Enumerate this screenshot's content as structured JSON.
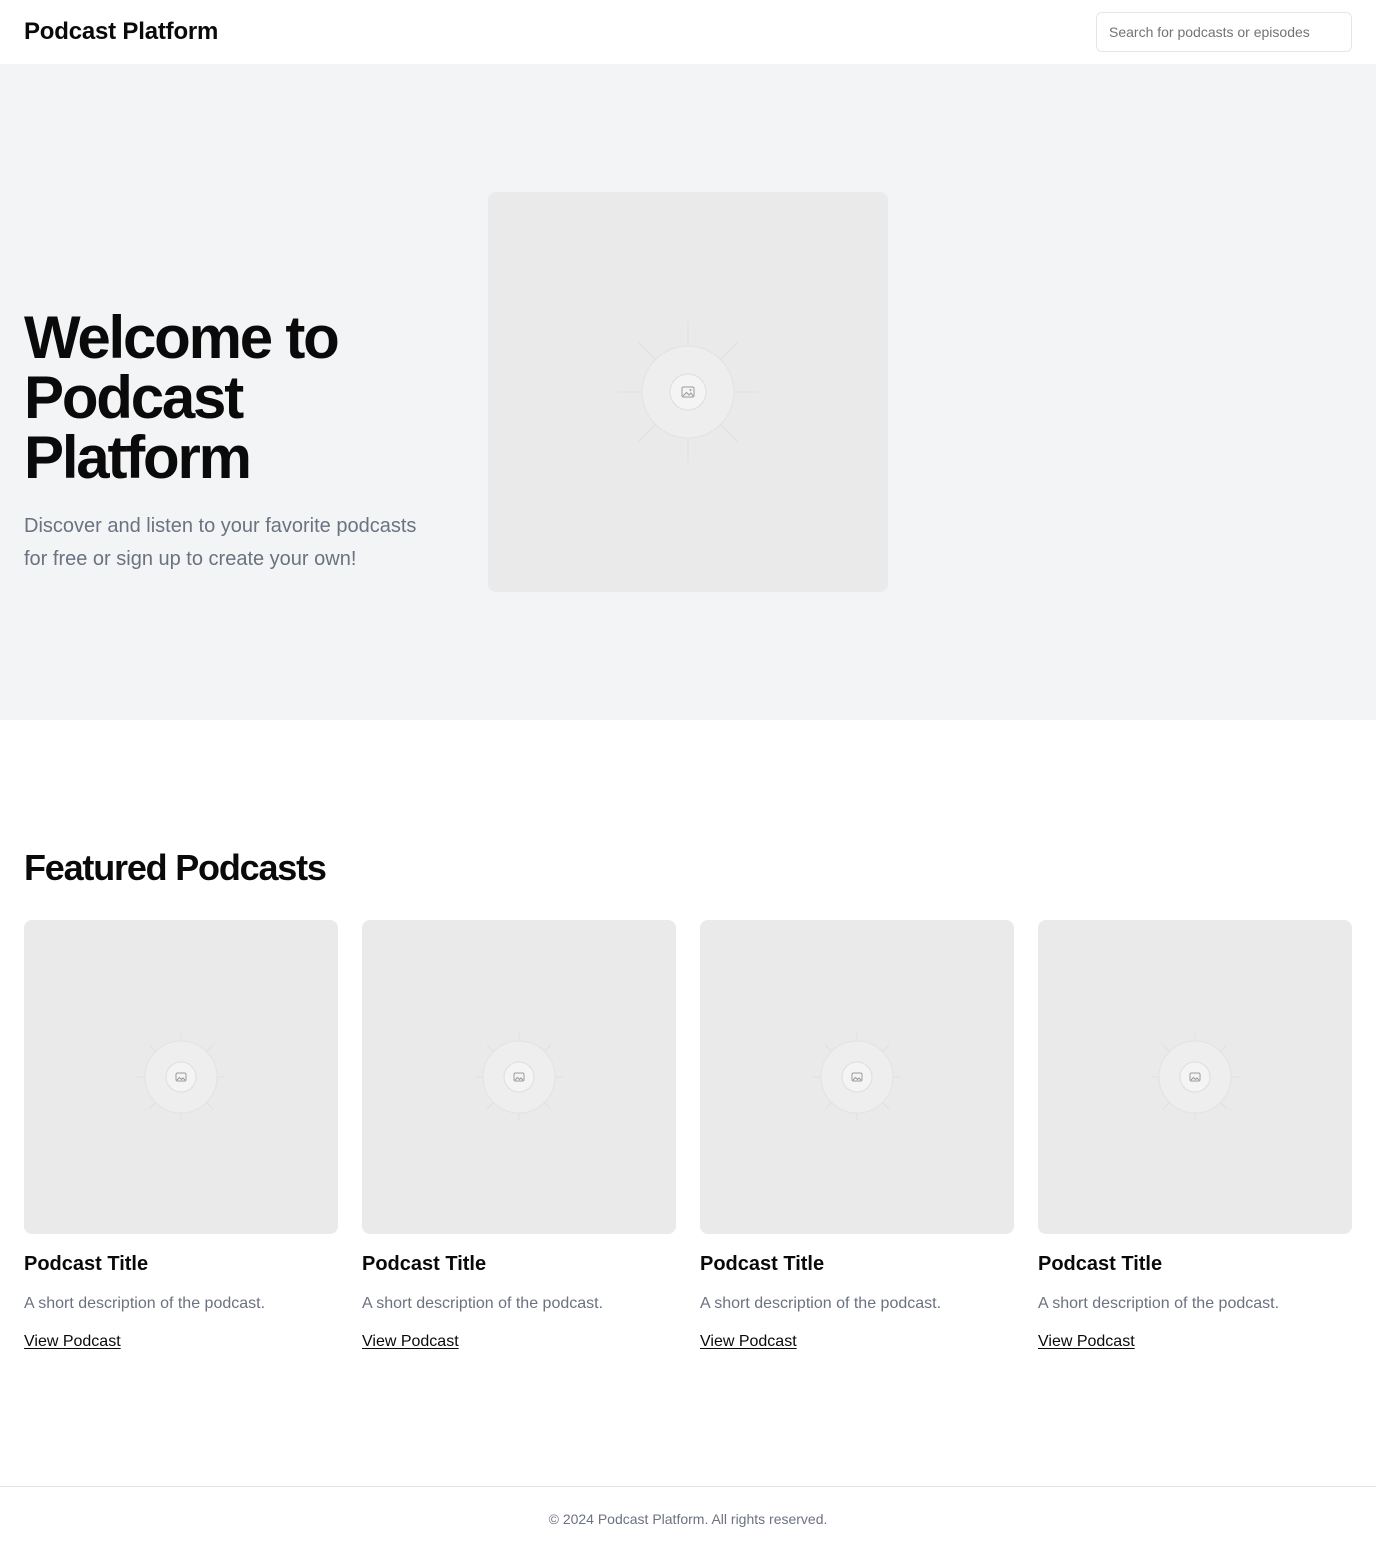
{
  "header": {
    "brand": "Podcast Platform",
    "search_placeholder": "Search for podcasts or episodes"
  },
  "hero": {
    "title": "Welcome to Podcast Platform",
    "subtitle": "Discover and listen to your favorite podcasts for free or sign up to create your own!",
    "image_icon": "image-placeholder-icon"
  },
  "featured": {
    "title": "Featured Podcasts",
    "cards": [
      {
        "title": "Podcast Title",
        "description": "A short description of the podcast.",
        "link": "View Podcast"
      },
      {
        "title": "Podcast Title",
        "description": "A short description of the podcast.",
        "link": "View Podcast"
      },
      {
        "title": "Podcast Title",
        "description": "A short description of the podcast.",
        "link": "View Podcast"
      },
      {
        "title": "Podcast Title",
        "description": "A short description of the podcast.",
        "link": "View Podcast"
      }
    ]
  },
  "footer": {
    "text": "© 2024 Podcast Platform. All rights reserved."
  },
  "colors": {
    "hero_background": "#f3f4f6",
    "placeholder_background": "#eaeaea",
    "muted_text": "#6b7280"
  }
}
